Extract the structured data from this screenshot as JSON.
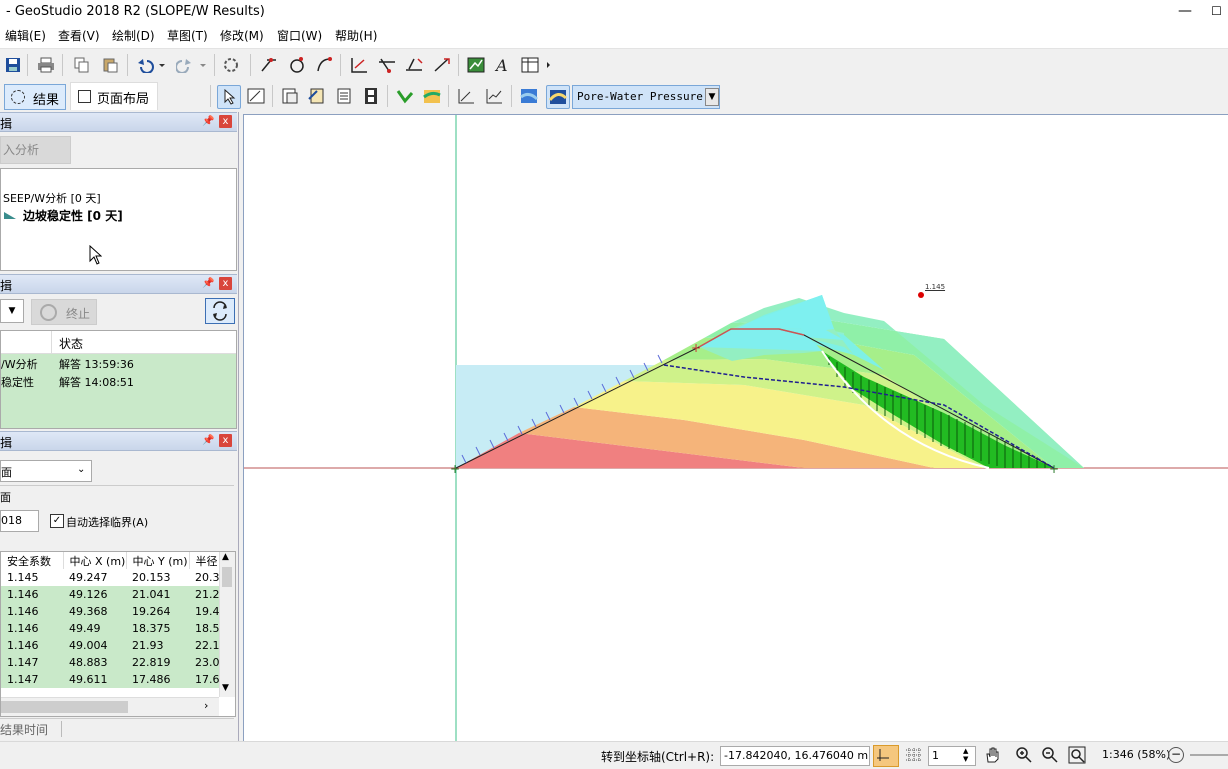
{
  "window": {
    "title": "- GeoStudio 2018 R2 (SLOPE/W Results)",
    "min": "—",
    "max": "☐"
  },
  "menu": [
    "编辑(E)",
    "查看(V)",
    "绘制(D)",
    "草图(T)",
    "修改(M)",
    "窗口(W)",
    "帮助(H)"
  ],
  "tabs": {
    "results": "结果",
    "layout": "页面布局"
  },
  "toolbar": {
    "contour_select": "Pore-Water Pressure"
  },
  "analysis_panel": {
    "button": "入分析",
    "tree": [
      {
        "label": "SEEP/W分析 [0 天]"
      },
      {
        "label": "边坡稳定性 [0 天]"
      }
    ]
  },
  "solve_panel": {
    "stop_button": "终止",
    "header_status": "状态",
    "rows": [
      {
        "name": "/W分析",
        "status": "解答 13:59:36"
      },
      {
        "name": "稳定性",
        "status": "解答 14:08:51"
      }
    ]
  },
  "slip_panel": {
    "dropdown": "面",
    "group_label": "面",
    "number_value": "018",
    "auto_select_label": "自动选择临界(A)",
    "columns": [
      "安全系数",
      "中心 X (m)",
      "中心 Y (m)",
      "半径"
    ],
    "rows": [
      [
        "1.145",
        "49.247",
        "20.153",
        "20.3"
      ],
      [
        "1.146",
        "49.126",
        "21.041",
        "21.2"
      ],
      [
        "1.146",
        "49.368",
        "19.264",
        "19.4"
      ],
      [
        "1.146",
        "49.49",
        "18.375",
        "18.5"
      ],
      [
        "1.146",
        "49.004",
        "21.93",
        "22.1"
      ],
      [
        "1.147",
        "48.883",
        "22.819",
        "23.0"
      ],
      [
        "1.147",
        "49.611",
        "17.486",
        "17.6"
      ]
    ]
  },
  "sidebar_footer": "结果时间",
  "canvas": {
    "fs_label": "1.145"
  },
  "status": {
    "goto_label": "转到坐标轴(Ctrl+R):",
    "coords": "-17.842040, 16.476040 m",
    "spin_value": "1",
    "scale": "1:346 (58%)"
  },
  "colors": {
    "accent": "#d9453b",
    "green_row": "#c9e9c9",
    "slice_green": "#22bb22",
    "water": "#c7ecf5"
  }
}
